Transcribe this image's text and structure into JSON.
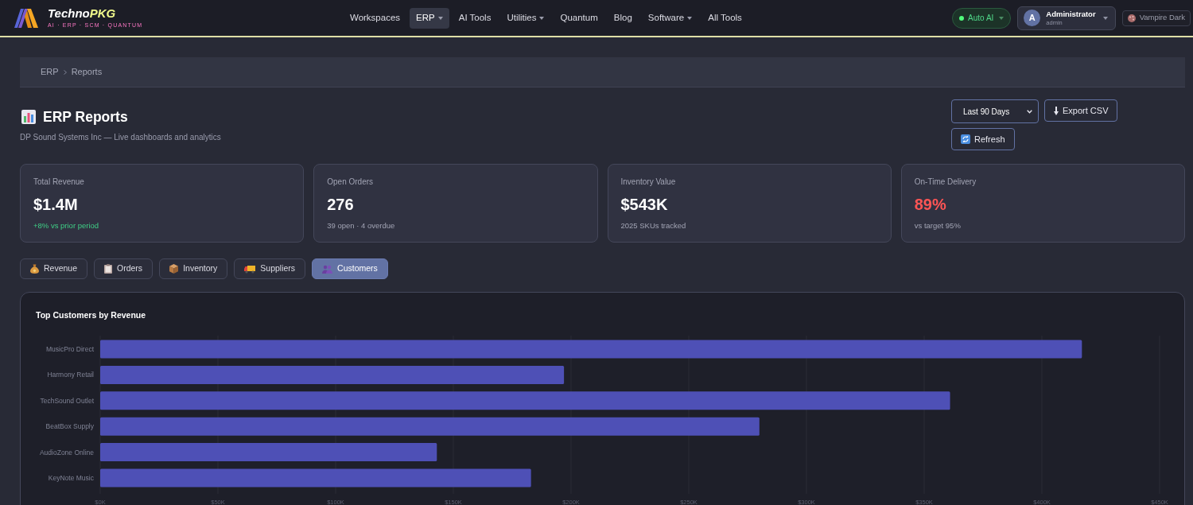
{
  "header": {
    "logo": {
      "name": "Techno",
      "name_accent": "PKG",
      "tagline": "AI · ERP · SCM · QUANTUM"
    },
    "nav": [
      {
        "label": "Workspaces",
        "selected": false,
        "has_menu": false
      },
      {
        "label": "ERP",
        "selected": true,
        "has_menu": true
      },
      {
        "label": "AI Tools",
        "selected": false,
        "has_menu": false
      },
      {
        "label": "Utilities",
        "selected": false,
        "has_menu": true
      },
      {
        "label": "Quantum",
        "selected": false,
        "has_menu": false
      },
      {
        "label": "Blog",
        "selected": false,
        "has_menu": false
      },
      {
        "label": "Software",
        "selected": false,
        "has_menu": true
      },
      {
        "label": "All Tools",
        "selected": false,
        "has_menu": false
      }
    ],
    "ai_mode": {
      "label": "Auto AI",
      "on": true
    },
    "user": {
      "initial": "A",
      "name": "Administrator",
      "role": "admin"
    },
    "theme_button": {
      "label": "Vampire Dark"
    }
  },
  "breadcrumb": [
    {
      "label": "ERP"
    },
    {
      "label": "Reports"
    }
  ],
  "page": {
    "title": "ERP Reports",
    "subtitle": "DP Sound Systems Inc — Live dashboards and analytics"
  },
  "controls": {
    "period_select": {
      "value": "Last 90 Days"
    },
    "buttons": [
      {
        "label": "Export CSV",
        "kind": "export"
      },
      {
        "label": "Refresh",
        "kind": "refresh"
      }
    ]
  },
  "stats": [
    {
      "label": "Total Revenue",
      "value": "$1.4M",
      "note": "+8% vs prior period",
      "value_alert": false,
      "note_positive": true
    },
    {
      "label": "Open Orders",
      "value": "276",
      "note": "39 open · 4 overdue",
      "value_alert": false,
      "note_positive": false
    },
    {
      "label": "Inventory Value",
      "value": "$543K",
      "note": "2025 SKUs tracked",
      "value_alert": false,
      "note_positive": false
    },
    {
      "label": "On-Time Delivery",
      "value": "89%",
      "note": "vs target 95%",
      "value_alert": true,
      "note_positive": false
    }
  ],
  "tabs": [
    {
      "label": "Revenue",
      "selected": false
    },
    {
      "label": "Orders",
      "selected": false
    },
    {
      "label": "Inventory",
      "selected": false
    },
    {
      "label": "Suppliers",
      "selected": false
    },
    {
      "label": "Customers",
      "selected": true
    }
  ],
  "chart_panel": {
    "title": "Top Customers by Revenue",
    "chart_data": {
      "type": "bar",
      "orientation": "horizontal",
      "grid": true,
      "categories": [
        "MusicPro Direct",
        "Harmony Retail",
        "TechSound Outlet",
        "BeatBox Supply",
        "AudioZone Online",
        "KeyNote Music"
      ],
      "values": [
        417000,
        197000,
        361000,
        280000,
        143000,
        183000
      ],
      "xlim": [
        0,
        450000
      ],
      "xticks": [
        {
          "value": 0,
          "label": "$0K"
        },
        {
          "value": 50000,
          "label": "$50K"
        },
        {
          "value": 100000,
          "label": "$100K"
        },
        {
          "value": 150000,
          "label": "$150K"
        },
        {
          "value": 200000,
          "label": "$200K"
        },
        {
          "value": 250000,
          "label": "$250K"
        },
        {
          "value": 300000,
          "label": "$300K"
        },
        {
          "value": 350000,
          "label": "$350K"
        },
        {
          "value": 400000,
          "label": "$400K"
        },
        {
          "value": 450000,
          "label": "$450K"
        }
      ]
    }
  }
}
